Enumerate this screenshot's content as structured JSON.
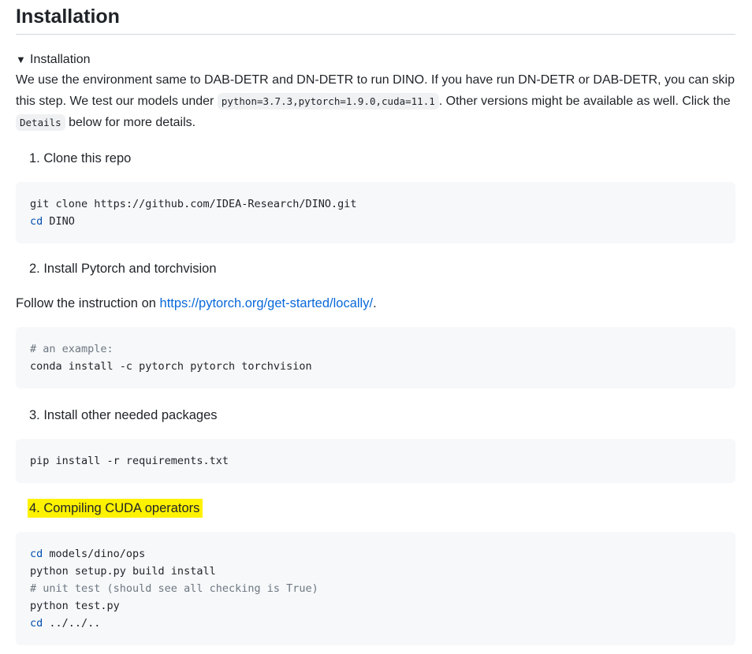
{
  "heading": "Installation",
  "summary": {
    "marker": "▼",
    "label": "Installation"
  },
  "intro": {
    "text1": "We use the environment same to DAB-DETR and DN-DETR to run DINO. If you have run DN-DETR or DAB-DETR, you can skip this step. We test our models under ",
    "code1": "python=3.7.3,pytorch=1.9.0,cuda=11.1",
    "text2": ". Other versions might be available as well. Click the ",
    "code2": "Details",
    "text3": " below for more details."
  },
  "steps": [
    {
      "label": "1. Clone this repo"
    },
    {
      "label": "2. Install Pytorch and torchvision"
    },
    {
      "label": "3. Install other needed packages"
    },
    {
      "label": "4. Compiling CUDA operators",
      "highlight_color": "#fff200"
    }
  ],
  "follow": {
    "text": "Follow the instruction on ",
    "link": "https://pytorch.org/get-started/locally/",
    "end": "."
  },
  "code_blocks": {
    "clone": {
      "l1": "git clone https://github.com/IDEA-Research/DINO.git",
      "l2_kw": "cd",
      "l2_rest": " DINO"
    },
    "pytorch": {
      "l1": "# an example:",
      "l2": "conda install -c pytorch pytorch torchvision"
    },
    "requirements": {
      "l1": "pip install -r requirements.txt"
    },
    "cuda": {
      "l1_kw": "cd",
      "l1_rest": " models/dino/ops",
      "l2": "python setup.py build install",
      "l3": "# unit test (should see all checking is True)",
      "l4": "python test.py",
      "l5_kw": "cd",
      "l5_rest": " ../../.."
    }
  },
  "colors": {
    "link": "#0969da",
    "keyword": "#0550ae",
    "comment": "#6e7781",
    "code_bg": "#f6f8fa",
    "highlight": "#fff200"
  }
}
